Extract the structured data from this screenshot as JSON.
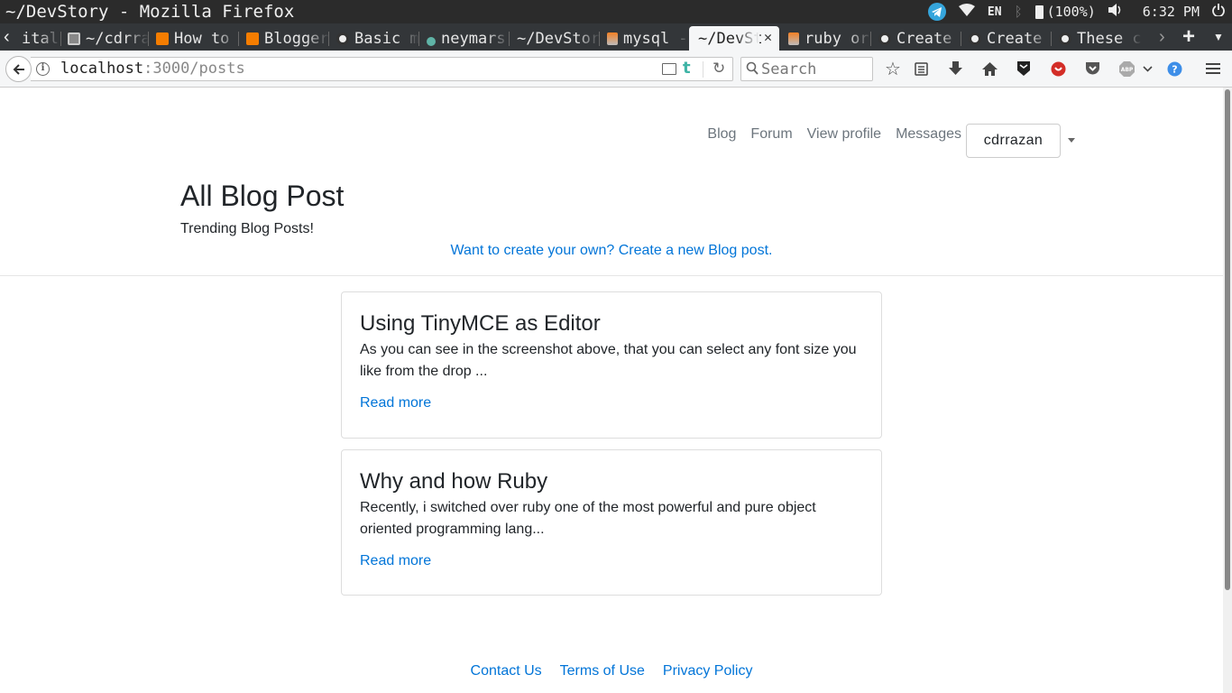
{
  "window": {
    "title": "~/DevStory - Mozilla Firefox",
    "tray": {
      "language": "EN",
      "battery": "(100%)",
      "time": "6:32 PM"
    }
  },
  "tabs": [
    {
      "label": "ital",
      "favicon": "generic-icon",
      "active": false
    },
    {
      "label": "~/cdrra",
      "favicon": "github-avatar-icon",
      "active": false
    },
    {
      "label": "How to",
      "favicon": "blogger-icon",
      "active": false
    },
    {
      "label": "Blogger",
      "favicon": "blogger-icon",
      "active": false
    },
    {
      "label": "Basic m",
      "favicon": "github-icon",
      "active": false
    },
    {
      "label": "neymars",
      "favicon": "ruby-dot-icon",
      "active": false
    },
    {
      "label": "~/DevStor",
      "favicon": "none",
      "active": false
    },
    {
      "label": "mysql -",
      "favicon": "stackoverflow-icon",
      "active": false
    },
    {
      "label": "~/DevSt",
      "favicon": "none",
      "active": true
    },
    {
      "label": "ruby or",
      "favicon": "stackoverflow-icon",
      "active": false
    },
    {
      "label": "Create",
      "favicon": "github-icon",
      "active": false
    },
    {
      "label": "Create",
      "favicon": "github-icon",
      "active": false
    },
    {
      "label": "These c",
      "favicon": "github-icon",
      "active": false
    }
  ],
  "navbar": {
    "url_host": "localhost",
    "url_rest": ":3000/posts",
    "search_placeholder": "Search",
    "reader_t": "t"
  },
  "site_nav": {
    "links": [
      "Blog",
      "Forum",
      "View profile",
      "Messages"
    ],
    "user": "cdrrazan"
  },
  "header": {
    "title": "All Blog Post",
    "subtitle": "Trending Blog Posts!",
    "create_link": "Want to create your own? Create a new Blog post."
  },
  "posts": [
    {
      "title": "Using TinyMCE as Editor",
      "excerpt": "As you can see in the screenshot above, that you can select any font size you like from the drop ...",
      "read_more": "Read more"
    },
    {
      "title": "Why and how Ruby",
      "excerpt": "Recently, i switched over ruby one of the most powerful and pure object oriented programming lang...",
      "read_more": "Read more"
    }
  ],
  "footer": {
    "links": [
      "Contact Us",
      "Terms of Use",
      "Privacy Policy"
    ]
  },
  "colors": {
    "link": "#0275d8",
    "muted": "#6c757d",
    "text": "#212529",
    "tab_strip": "#333639",
    "title_bar": "#2b2b2b"
  }
}
